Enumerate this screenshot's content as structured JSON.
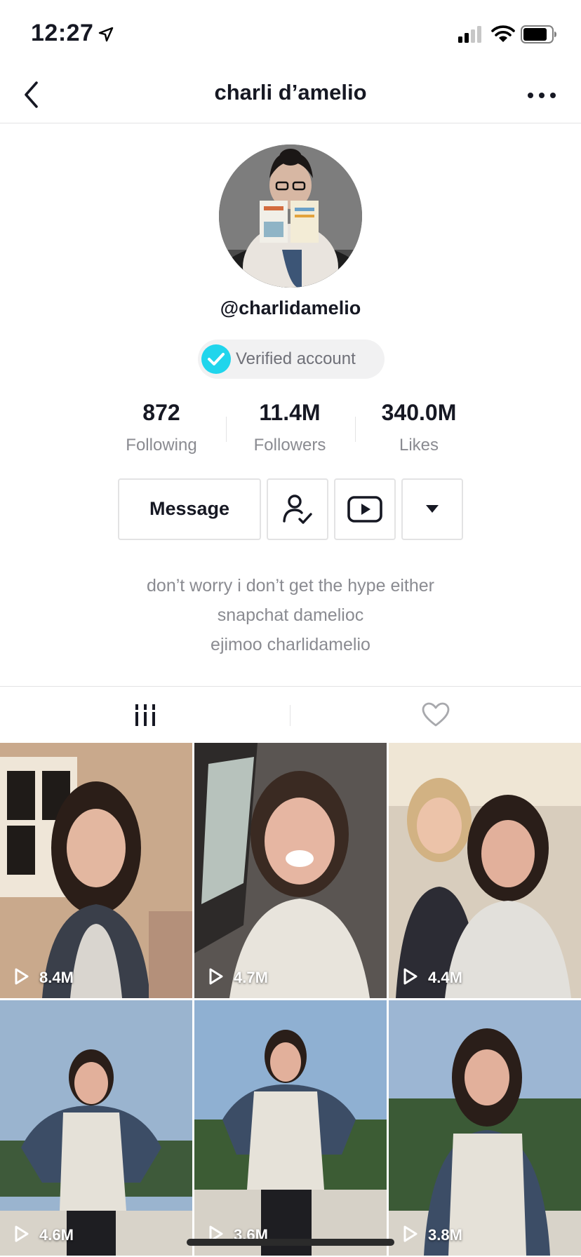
{
  "status_bar": {
    "time": "12:27"
  },
  "nav": {
    "title": "charli d’amelio"
  },
  "profile": {
    "username": "@charlidamelio",
    "verified_label": "Verified account",
    "stats": [
      {
        "value": "872",
        "label": "Following"
      },
      {
        "value": "11.4M",
        "label": "Followers"
      },
      {
        "value": "340.0M",
        "label": "Likes"
      }
    ],
    "message_label": "Message",
    "bio": [
      "don’t worry i don’t get the hype either",
      "snapchat damelioc",
      "ejimoo charlidamelio"
    ]
  },
  "videos": [
    {
      "views": "8.4M"
    },
    {
      "views": "4.7M"
    },
    {
      "views": "4.4M"
    },
    {
      "views": "4.6M"
    },
    {
      "views": "3.6M"
    },
    {
      "views": "3.8M"
    }
  ],
  "colors": {
    "verified": "#20d5ec",
    "text": "#161823",
    "muted": "#8a8b91",
    "border": "#e3e3e4"
  },
  "icons": [
    "location-arrow-icon",
    "signal-icon",
    "wifi-icon",
    "battery-icon",
    "back-icon",
    "more-icon",
    "verified-check-icon",
    "user-check-icon",
    "youtube-icon",
    "caret-down-icon",
    "grid-icon",
    "heart-icon",
    "play-icon"
  ]
}
